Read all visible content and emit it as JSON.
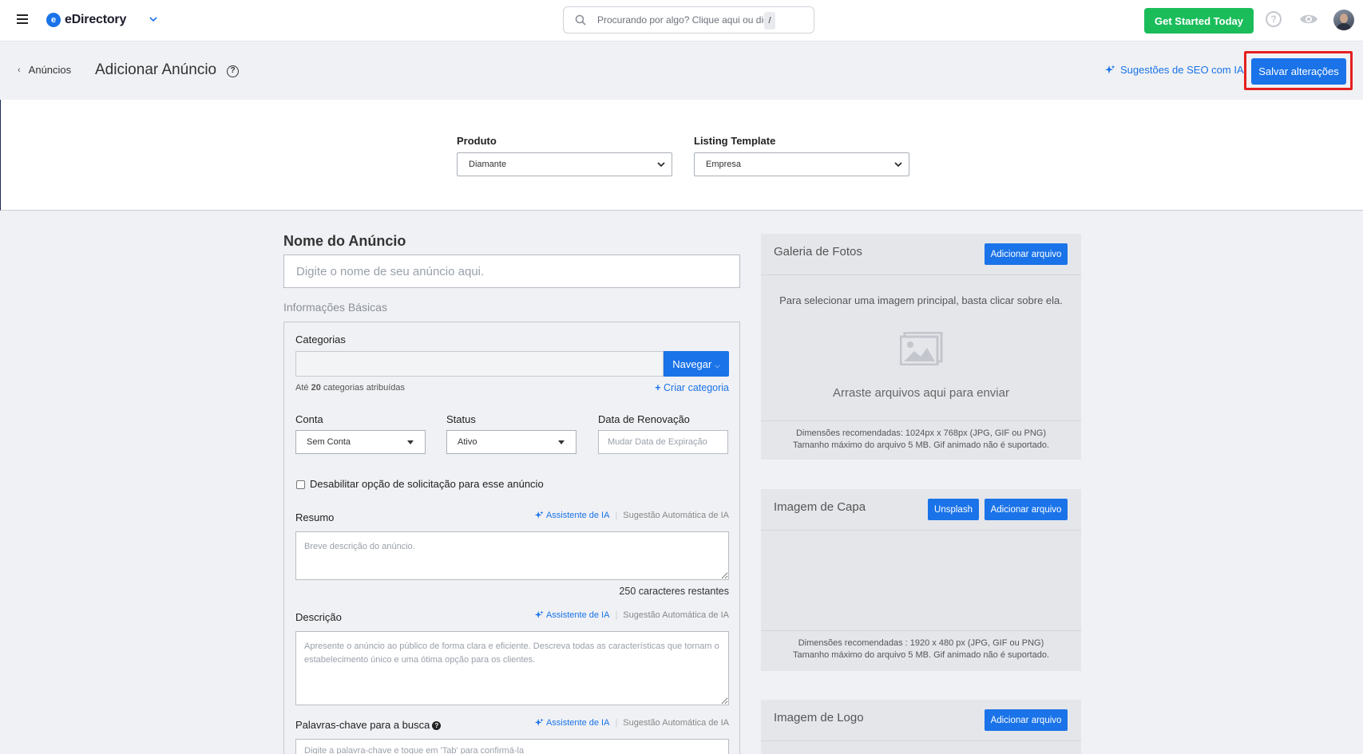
{
  "topbar": {
    "brand": "eDirectory",
    "search_placeholder": "Procurando por algo? Clique aqui ou digite",
    "search_shortcut": "/",
    "get_started": "Get Started Today",
    "help_glyph": "?"
  },
  "header": {
    "back_label": "Anúncios",
    "title": "Adicionar Anúncio",
    "help_glyph": "?",
    "seo_ai": "Sugestões de SEO com IA",
    "save": "Salvar alterações"
  },
  "product": {
    "product_label": "Produto",
    "product_value": "Diamante",
    "template_label": "Listing Template",
    "template_value": "Empresa"
  },
  "form": {
    "name_title": "Nome do Anúncio",
    "name_placeholder": "Digite o nome de seu anúncio aqui.",
    "basic_info": "Informações Básicas",
    "categories_label": "Categorias",
    "navegar": "Navegar",
    "categories_hint_prefix": "Até",
    "categories_hint_count": "20",
    "categories_hint_suffix": "categorias atribuídas",
    "criar_categoria": "Criar categoria",
    "conta_label": "Conta",
    "conta_value": "Sem Conta",
    "status_label": "Status",
    "status_value": "Ativo",
    "renewal_label": "Data de Renovação",
    "renewal_placeholder": "Mudar Data de Expiração",
    "disable_request": "Desabilitar opção de solicitação para esse anúncio",
    "resumo_label": "Resumo",
    "ai_assistant": "Assistente de IA",
    "ai_auto": "Sugestão Automática de IA",
    "resumo_placeholder": "Breve descrição do anúncio.",
    "remaining": "250 caracteres restantes",
    "descricao_label": "Descrição",
    "descricao_placeholder": "Apresente o anúncio ao público de forma clara e eficiente. Descreva todas as características que tornam o estabelecimento único e uma ótima opção para os clientes.",
    "keywords_label": "Palavras-chave para a busca",
    "keywords_help": "?",
    "keywords_placeholder": "Digite a palavra-chave e toque em 'Tab' para confirmá-la"
  },
  "gallery": {
    "title": "Galeria de Fotos",
    "add_file": "Adicionar arquivo",
    "hint": "Para selecionar uma imagem principal, basta clicar sobre ela.",
    "drop": "Arraste arquivos aqui para enviar",
    "dims": "Dimensões recomendadas: 1024px x 768px (JPG, GIF ou PNG)",
    "max": "Tamanho máximo do arquivo 5 MB. Gif animado não é suportado."
  },
  "cover": {
    "title": "Imagem de Capa",
    "unsplash": "Unsplash",
    "add_file": "Adicionar arquivo",
    "dims": "Dimensões recomendadas : 1920 x 480 px (JPG, GIF ou PNG)",
    "max": "Tamanho máximo do arquivo 5 MB. Gif animado não é suportado."
  },
  "logo_card": {
    "title": "Imagem de Logo",
    "add_file": "Adicionar arquivo"
  },
  "colors": {
    "primary": "#1a73e8",
    "success": "#1bbd5b",
    "highlight": "#e52020"
  }
}
